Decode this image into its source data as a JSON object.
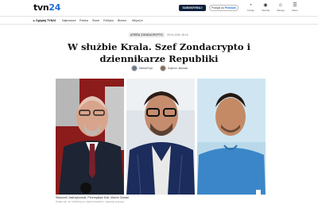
{
  "header": {
    "logo_tvn": "tvn",
    "logo_num": "24",
    "subscribe_label": "SUBSKRYBUJ",
    "premium_prefix": "Przejdź do",
    "premium_brand": "Premium",
    "icons": [
      {
        "name": "reading-icon",
        "glyph": "◔",
        "label": "Czytaj"
      },
      {
        "name": "listen-icon",
        "glyph": "◉",
        "label": "Słuchaj"
      },
      {
        "name": "account-icon",
        "glyph": "☺",
        "label": "Zaloguj"
      },
      {
        "name": "menu-icon",
        "glyph": "☰",
        "label": "Menu"
      }
    ]
  },
  "nav": {
    "items": [
      "Oglądaj TVN24",
      "Najnowsze",
      "Polska",
      "Świat",
      "Polityka",
      "Biznes",
      "Więcej"
    ]
  },
  "article": {
    "category": "AFERA ZONDACRYPTO",
    "date": "09.04.2026, 08:16",
    "headline": "W służbie Krala. Szef Zondacrypto i dziennikarze Republiki",
    "authors": [
      {
        "name": "Michał Fuja"
      },
      {
        "name": "Szymon Jadczak"
      }
    ],
    "caption": "Sławomir Jastrzębowski, Przemysław Kral, Marcin Dobski",
    "credit": "Źródło zdj.: pb / PAP/Forum, Marcin Dobski/X, materiały prasowe"
  },
  "colors": {
    "brand_blue": "#1f6fe0",
    "subscribe_bg": "#0b1f3a"
  }
}
